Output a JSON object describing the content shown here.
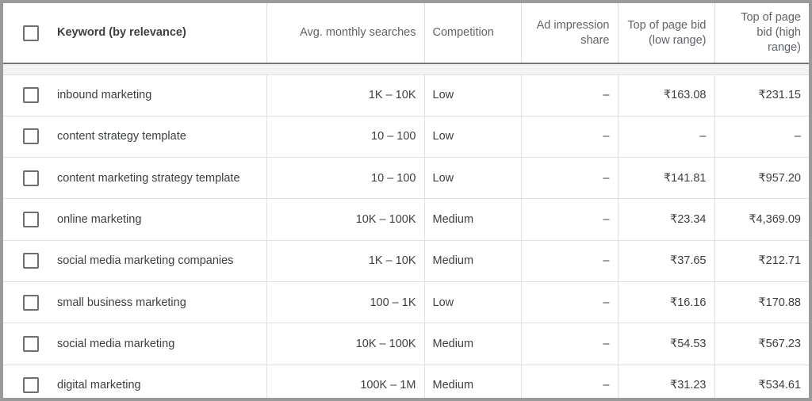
{
  "table": {
    "headers": {
      "select_all": "select-all",
      "keyword": "Keyword (by relevance)",
      "avg_monthly_searches": "Avg. monthly searches",
      "competition": "Competition",
      "ad_impression_share": "Ad impression share",
      "bid_low": "Top of page bid (low range)",
      "bid_high": "Top of page bid (high range)"
    },
    "rows": [
      {
        "keyword": "inbound marketing",
        "avg": "1K – 10K",
        "competition": "Low",
        "impression": "–",
        "bid_low": "₹163.08",
        "bid_high": "₹231.15",
        "checked": false
      },
      {
        "keyword": "content strategy template",
        "avg": "10 – 100",
        "competition": "Low",
        "impression": "–",
        "bid_low": "–",
        "bid_high": "–",
        "checked": false
      },
      {
        "keyword": "content marketing strategy template",
        "avg": "10 – 100",
        "competition": "Low",
        "impression": "–",
        "bid_low": "₹141.81",
        "bid_high": "₹957.20",
        "checked": false
      },
      {
        "keyword": "online marketing",
        "avg": "10K – 100K",
        "competition": "Medium",
        "impression": "–",
        "bid_low": "₹23.34",
        "bid_high": "₹4,369.09",
        "checked": false
      },
      {
        "keyword": "social media marketing companies",
        "avg": "1K – 10K",
        "competition": "Medium",
        "impression": "–",
        "bid_low": "₹37.65",
        "bid_high": "₹212.71",
        "checked": false
      },
      {
        "keyword": "small business marketing",
        "avg": "100 – 1K",
        "competition": "Low",
        "impression": "–",
        "bid_low": "₹16.16",
        "bid_high": "₹170.88",
        "checked": false
      },
      {
        "keyword": "social media marketing",
        "avg": "10K – 100K",
        "competition": "Medium",
        "impression": "–",
        "bid_low": "₹54.53",
        "bid_high": "₹567.23",
        "checked": false
      },
      {
        "keyword": "digital marketing",
        "avg": "100K – 1M",
        "competition": "Medium",
        "impression": "–",
        "bid_low": "₹31.23",
        "bid_high": "₹534.61",
        "checked": false
      }
    ]
  }
}
